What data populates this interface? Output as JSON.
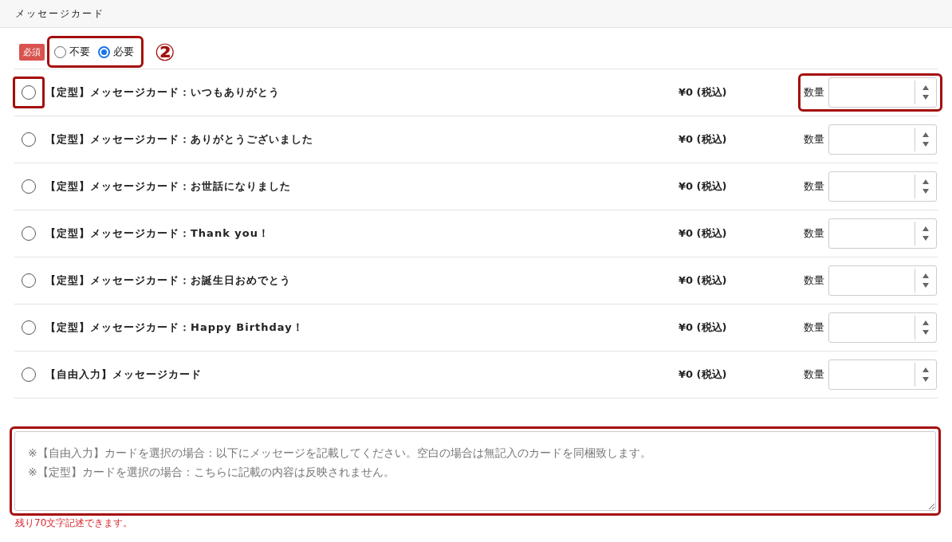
{
  "section_title": "メッセージカード",
  "requirement": {
    "badge": "必須",
    "highlighted": true,
    "marker": "②",
    "options": [
      {
        "label": "不要",
        "selected": false
      },
      {
        "label": "必要",
        "selected": true
      }
    ]
  },
  "cards": [
    {
      "name": "【定型】メッセージカード：いつもありがとう",
      "price": "¥0 (税込)",
      "quantity_label": "数量",
      "selected": false,
      "radio_highlighted": true,
      "quantity_highlighted": true
    },
    {
      "name": "【定型】メッセージカード：ありがとうございました",
      "price": "¥0 (税込)",
      "quantity_label": "数量",
      "selected": false,
      "radio_highlighted": false,
      "quantity_highlighted": false
    },
    {
      "name": "【定型】メッセージカード：お世話になりました",
      "price": "¥0 (税込)",
      "quantity_label": "数量",
      "selected": false,
      "radio_highlighted": false,
      "quantity_highlighted": false
    },
    {
      "name": "【定型】メッセージカード：Thank you！",
      "price": "¥0 (税込)",
      "quantity_label": "数量",
      "selected": false,
      "radio_highlighted": false,
      "quantity_highlighted": false
    },
    {
      "name": "【定型】メッセージカード：お誕生日おめでとう",
      "price": "¥0 (税込)",
      "quantity_label": "数量",
      "selected": false,
      "radio_highlighted": false,
      "quantity_highlighted": false
    },
    {
      "name": "【定型】メッセージカード：Happy Birthday！",
      "price": "¥0 (税込)",
      "quantity_label": "数量",
      "selected": false,
      "radio_highlighted": false,
      "quantity_highlighted": false
    },
    {
      "name": "【自由入力】メッセージカード",
      "price": "¥0 (税込)",
      "quantity_label": "数量",
      "selected": false,
      "radio_highlighted": false,
      "quantity_highlighted": false
    }
  ],
  "message": {
    "placeholder": "※【自由入力】カードを選択の場合：以下にメッセージを記載してください。空白の場合は無記入のカードを同梱致します。\n※【定型】カードを選択の場合：こちらに記載の内容は反映されません。",
    "highlighted": true,
    "counter": "残り70文字記述できます。"
  }
}
